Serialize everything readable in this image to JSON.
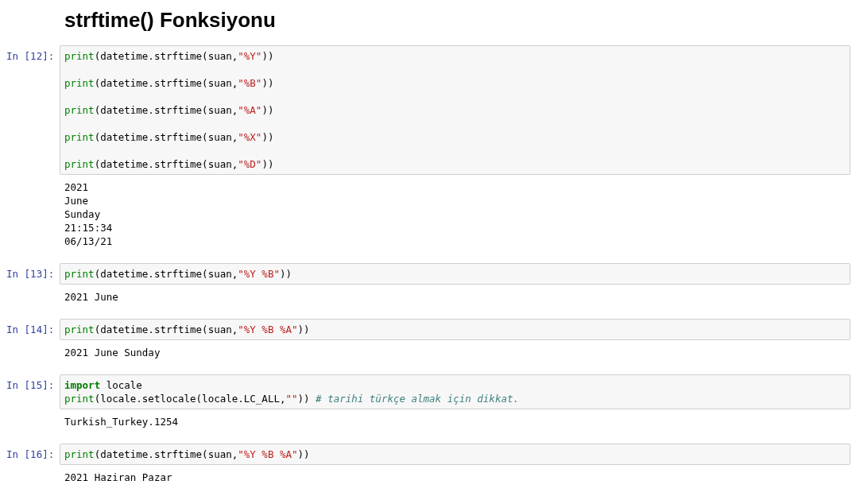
{
  "heading": "strftime() Fonksiyonu",
  "cells": [
    {
      "prompt": "In [12]:",
      "lines": [
        {
          "kind": "code",
          "tokens": [
            {
              "kind": "builtin",
              "text": "print"
            },
            {
              "kind": "plain",
              "text": "(datetime.strftime(suan,"
            },
            {
              "kind": "string",
              "text": "\"%Y\""
            },
            {
              "kind": "plain",
              "text": "))"
            }
          ]
        },
        {
          "kind": "blank"
        },
        {
          "kind": "code",
          "tokens": [
            {
              "kind": "builtin",
              "text": "print"
            },
            {
              "kind": "plain",
              "text": "(datetime.strftime(suan,"
            },
            {
              "kind": "string",
              "text": "\"%B\""
            },
            {
              "kind": "plain",
              "text": "))"
            }
          ]
        },
        {
          "kind": "blank"
        },
        {
          "kind": "code",
          "tokens": [
            {
              "kind": "builtin",
              "text": "print"
            },
            {
              "kind": "plain",
              "text": "(datetime.strftime(suan,"
            },
            {
              "kind": "string",
              "text": "\"%A\""
            },
            {
              "kind": "plain",
              "text": "))"
            }
          ]
        },
        {
          "kind": "blank"
        },
        {
          "kind": "code",
          "tokens": [
            {
              "kind": "builtin",
              "text": "print"
            },
            {
              "kind": "plain",
              "text": "(datetime.strftime(suan,"
            },
            {
              "kind": "string",
              "text": "\"%X\""
            },
            {
              "kind": "plain",
              "text": "))"
            }
          ]
        },
        {
          "kind": "blank"
        },
        {
          "kind": "code",
          "tokens": [
            {
              "kind": "builtin",
              "text": "print"
            },
            {
              "kind": "plain",
              "text": "(datetime.strftime(suan,"
            },
            {
              "kind": "string",
              "text": "\"%D\""
            },
            {
              "kind": "plain",
              "text": "))"
            }
          ]
        }
      ],
      "output": [
        "2021",
        "June",
        "Sunday",
        "21:15:34",
        "06/13/21"
      ]
    },
    {
      "prompt": "In [13]:",
      "lines": [
        {
          "kind": "code",
          "tokens": [
            {
              "kind": "builtin",
              "text": "print"
            },
            {
              "kind": "plain",
              "text": "(datetime.strftime(suan,"
            },
            {
              "kind": "string",
              "text": "\"%Y %B\""
            },
            {
              "kind": "plain",
              "text": "))"
            }
          ]
        }
      ],
      "output": [
        "2021 June"
      ]
    },
    {
      "prompt": "In [14]:",
      "lines": [
        {
          "kind": "code",
          "tokens": [
            {
              "kind": "builtin",
              "text": "print"
            },
            {
              "kind": "plain",
              "text": "(datetime.strftime(suan,"
            },
            {
              "kind": "string",
              "text": "\"%Y %B %A\""
            },
            {
              "kind": "plain",
              "text": "))"
            }
          ]
        }
      ],
      "output": [
        "2021 June Sunday"
      ]
    },
    {
      "prompt": "In [15]:",
      "lines": [
        {
          "kind": "code",
          "tokens": [
            {
              "kind": "keyword",
              "text": "import"
            },
            {
              "kind": "plain",
              "text": " locale"
            }
          ]
        },
        {
          "kind": "code",
          "tokens": [
            {
              "kind": "builtin",
              "text": "print"
            },
            {
              "kind": "plain",
              "text": "(locale.setlocale(locale.LC_ALL,"
            },
            {
              "kind": "string",
              "text": "\"\""
            },
            {
              "kind": "plain",
              "text": ")) "
            },
            {
              "kind": "comment",
              "text": "# tarihi türkçe almak için dikkat."
            }
          ]
        }
      ],
      "output": [
        "Turkish_Turkey.1254"
      ]
    },
    {
      "prompt": "In [16]:",
      "lines": [
        {
          "kind": "code",
          "tokens": [
            {
              "kind": "builtin",
              "text": "print"
            },
            {
              "kind": "plain",
              "text": "(datetime.strftime(suan,"
            },
            {
              "kind": "string",
              "text": "\"%Y %B %A\""
            },
            {
              "kind": "plain",
              "text": "))"
            }
          ]
        }
      ],
      "output": [
        "2021 Haziran Pazar"
      ]
    }
  ]
}
